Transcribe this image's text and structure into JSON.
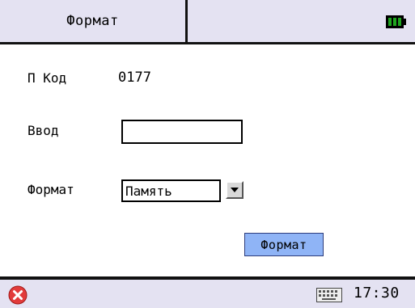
{
  "header": {
    "title": "Формат",
    "battery_icon": "battery-icon"
  },
  "form": {
    "code_label": "П Код",
    "code_value": "0177",
    "input_label": "Ввод",
    "input_value": "",
    "format_label": "Формат",
    "format_selected": "Память",
    "dropdown_icon": "chevron-down-icon",
    "submit_label": "Формат"
  },
  "taskbar": {
    "close_icon": "close-icon",
    "keyboard_icon": "keyboard-icon",
    "time": "17:30"
  },
  "colors": {
    "bar_background": "#e4e2f2",
    "button_background": "#8fb4f6",
    "close_red": "#e23b3b",
    "battery_green": "#1fa51f"
  }
}
